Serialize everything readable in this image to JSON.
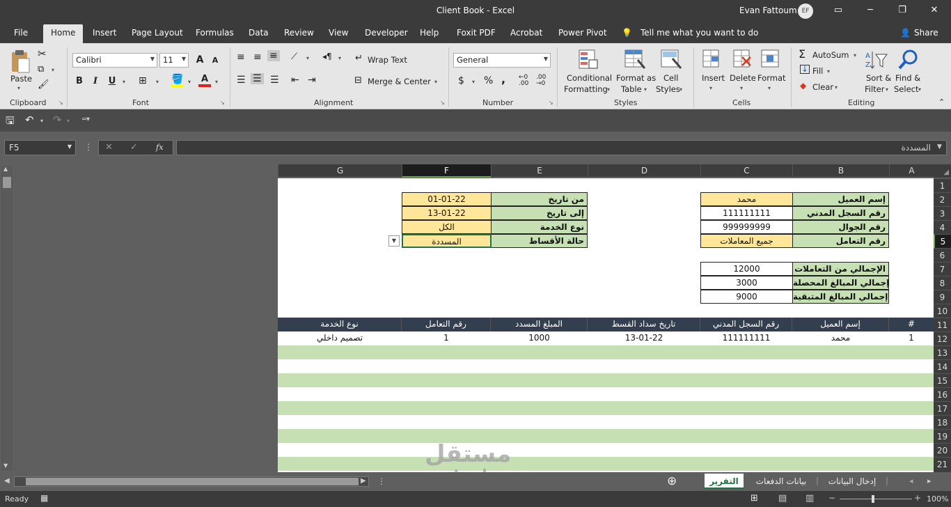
{
  "window": {
    "title": "Client Book  -  Excel",
    "user": "Evan Fattoum",
    "avatar": "EF",
    "share": "Share"
  },
  "menu": {
    "tabs": [
      "File",
      "Home",
      "Insert",
      "Page Layout",
      "Formulas",
      "Data",
      "Review",
      "View",
      "Developer",
      "Help",
      "Foxit PDF",
      "Acrobat",
      "Power Pivot"
    ],
    "active": "Home",
    "tell_me": "Tell me what you want to do"
  },
  "ribbon": {
    "clipboard": {
      "label": "Clipboard",
      "paste": "Paste"
    },
    "font": {
      "label": "Font",
      "name": "Calibri",
      "size": "11",
      "bold": "B",
      "italic": "I",
      "underline": "U",
      "grow": "A",
      "shrink": "A",
      "font_color": "A"
    },
    "alignment": {
      "label": "Alignment",
      "wrap": "Wrap Text",
      "merge": "Merge & Center"
    },
    "number": {
      "label": "Number",
      "format": "General",
      "currency": "$",
      "percent": "%",
      "comma": ","
    },
    "styles": {
      "label": "Styles",
      "conditional": [
        "Conditional",
        "Formatting"
      ],
      "format_table": [
        "Format as",
        "Table"
      ],
      "cell_styles": [
        "Cell",
        "Styles"
      ]
    },
    "cells": {
      "label": "Cells",
      "insert": "Insert",
      "delete": "Delete",
      "format": "Format"
    },
    "editing": {
      "label": "Editing",
      "autosum": "AutoSum",
      "fill": "Fill",
      "clear": "Clear",
      "sort": [
        "Sort &",
        "Filter"
      ],
      "find": [
        "Find &",
        "Select"
      ]
    }
  },
  "formula_bar": {
    "name_box": "F5",
    "fx": "fx",
    "content": "المسددة"
  },
  "columns": [
    "G",
    "F",
    "E",
    "D",
    "C",
    "B",
    "A"
  ],
  "selected_column": "F",
  "rows": [
    "1",
    "2",
    "3",
    "4",
    "5",
    "6",
    "7",
    "8",
    "9",
    "10",
    "11",
    "12",
    "13",
    "14",
    "15",
    "16",
    "17",
    "18",
    "19",
    "20",
    "21"
  ],
  "selected_row": "5",
  "client": {
    "name_label": "إسم العميل",
    "name": "محمد",
    "reg_label": "رقم السجل المدني",
    "reg": "111111111",
    "mobile_label": "رقم الجوال",
    "mobile": "999999999",
    "txn_label": "رقم التعامل",
    "txn": "جميع المعاملات"
  },
  "filters": {
    "from_label": "من تاريخ",
    "from": "01-01-22",
    "to_label": "إلى تاريخ",
    "to": "13-01-22",
    "service_label": "نوع الخدمة",
    "service": "الكل",
    "status_label": "حالة الأقساط",
    "status": "المسددة"
  },
  "totals": {
    "total_label": "الإجمالي من التعاملات",
    "total": "12000",
    "collected_label": "إجمالي المبالغ المحصلة",
    "collected": "3000",
    "remaining_label": "إجمالي المبالغ المتبقية",
    "remaining": "9000"
  },
  "table": {
    "headers": [
      "#",
      "إسم العميل",
      "رقم السجل المدني",
      "تاريخ سداد القسط",
      "المبلغ المسدد",
      "رقم التعامل",
      "نوع الخدمة"
    ],
    "rows": [
      [
        "1",
        "محمد",
        "111111111",
        "13-01-22",
        "1000",
        "1",
        "تصميم داخلي"
      ]
    ]
  },
  "sheets": {
    "tabs": [
      "إدخال البيانات",
      "بيانات الدفعات",
      "التقرير"
    ],
    "active": "التقرير"
  },
  "status": {
    "ready": "Ready",
    "zoom": "100%"
  },
  "watermark": {
    "arabic": "مستقل",
    "latin": "mostaql.com"
  }
}
